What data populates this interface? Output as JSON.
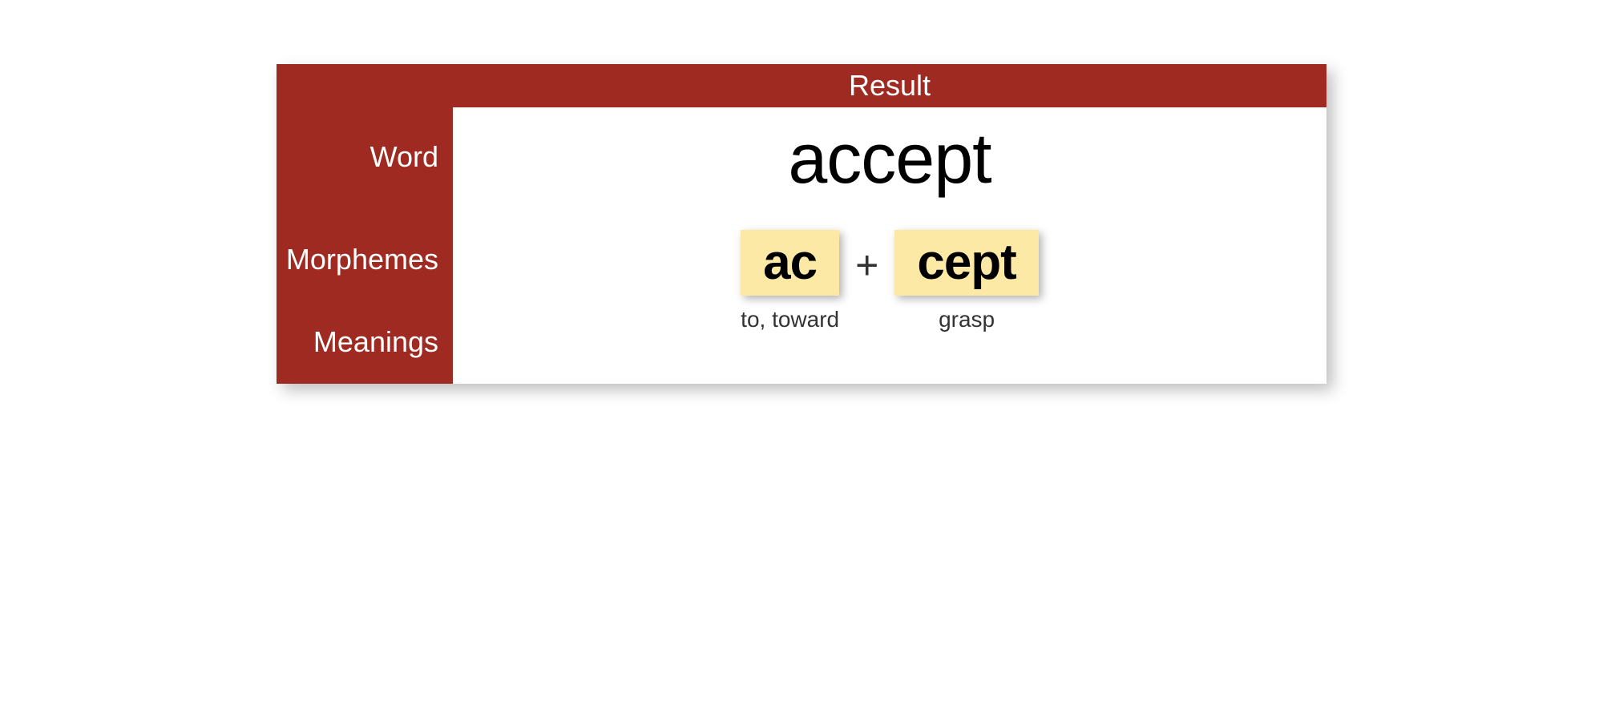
{
  "header": {
    "title": "Result"
  },
  "labels": {
    "word": "Word",
    "morphemes": "Morphemes",
    "meanings": "Meanings"
  },
  "result": {
    "word": "accept",
    "separator": "+",
    "morphemes": [
      {
        "text": "ac",
        "meaning": "to, toward"
      },
      {
        "text": "cept",
        "meaning": "grasp"
      }
    ]
  },
  "colors": {
    "accent": "#9e2a21",
    "tile": "#fce9a6"
  }
}
